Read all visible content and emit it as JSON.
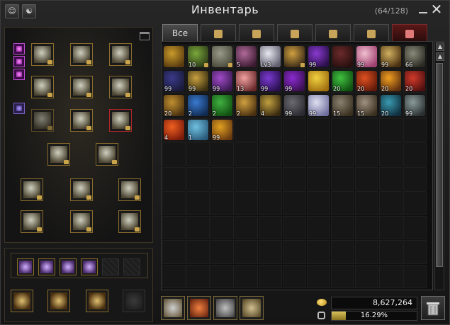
{
  "window": {
    "title": "Инвентарь",
    "slots_used": "(64/128)"
  },
  "tabs": [
    {
      "label": "Все",
      "icon": null,
      "active": true
    },
    {
      "icon": "helmet-icon"
    },
    {
      "icon": "potion-icon"
    },
    {
      "icon": "hammer-icon"
    },
    {
      "icon": "chest-icon"
    },
    {
      "icon": "scroll-icon"
    },
    {
      "icon": "gem-icon",
      "red": true
    }
  ],
  "grid": {
    "columns": 11,
    "rows": 10,
    "items": [
      {
        "c": "#c89a2a",
        "c2": "#5a3b10",
        "qty": ""
      },
      {
        "c": "#7aa83a",
        "c2": "#2c3a18",
        "qty": "10",
        "lock": true
      },
      {
        "c": "#9a9a8a",
        "c2": "#4a4a3a",
        "qty": "",
        "lock": true
      },
      {
        "c": "#b06a9a",
        "c2": "#3a1a30",
        "qty": "5"
      },
      {
        "c": "#e8e8f0",
        "c2": "#606070",
        "qty": "Lv3"
      },
      {
        "c": "#d0a040",
        "c2": "#3a2a18",
        "qty": "",
        "lock": true
      },
      {
        "c": "#8a3ad0",
        "c2": "#2a0f4a",
        "qty": "99"
      },
      {
        "c": "#6a2a2a",
        "c2": "#2a0f0f",
        "qty": ""
      },
      {
        "c": "#f0c0d0",
        "c2": "#a04070",
        "qty": "99"
      },
      {
        "c": "#d0b060",
        "c2": "#4a3010",
        "qty": "99"
      },
      {
        "c": "#8a8a7a",
        "c2": "#2a2a22",
        "qty": "66"
      },
      {
        "c": "#3a3a8a",
        "c2": "#1a1a3a",
        "qty": "99"
      },
      {
        "c": "#c8a040",
        "c2": "#3a3010",
        "qty": "99"
      },
      {
        "c": "#a04ac8",
        "c2": "#3a1a50",
        "qty": "99"
      },
      {
        "c": "#f0a0a0",
        "c2": "#6a2a2a",
        "qty": "13"
      },
      {
        "c": "#7a3ad0",
        "c2": "#2a1050",
        "qty": "99"
      },
      {
        "c": "#8a2ad0",
        "c2": "#3a1050",
        "qty": "99"
      },
      {
        "c": "#f0d040",
        "c2": "#a07010",
        "qty": ""
      },
      {
        "c": "#40c040",
        "c2": "#105010",
        "qty": "20"
      },
      {
        "c": "#e05020",
        "c2": "#601a0a",
        "qty": "20"
      },
      {
        "c": "#f0a020",
        "c2": "#603010",
        "qty": "20"
      },
      {
        "c": "#d03a2a",
        "c2": "#501010",
        "qty": "20"
      },
      {
        "c": "#c09030",
        "c2": "#4a3010",
        "qty": "20"
      },
      {
        "c": "#3a7ad0",
        "c2": "#102a50",
        "qty": "2"
      },
      {
        "c": "#40b040",
        "c2": "#105010",
        "qty": "2"
      },
      {
        "c": "#d0a040",
        "c2": "#4a3010",
        "qty": "2"
      },
      {
        "c": "#c0a040",
        "c2": "#3a2a10",
        "qty": "4"
      },
      {
        "c": "#6a6a70",
        "c2": "#2a2a30",
        "qty": "99"
      },
      {
        "c": "#e0e0f0",
        "c2": "#7070a0",
        "qty": "99"
      },
      {
        "c": "#8a8070",
        "c2": "#3a3020",
        "qty": "15"
      },
      {
        "c": "#a09080",
        "c2": "#3a3020",
        "qty": "15"
      },
      {
        "c": "#3a9ab0",
        "c2": "#103040",
        "qty": "20"
      },
      {
        "c": "#8a9a9a",
        "c2": "#2a3030",
        "qty": "99"
      },
      {
        "c": "#f06020",
        "c2": "#7a1a0a",
        "qty": "4"
      },
      {
        "c": "#70c0e0",
        "c2": "#2a5a7a",
        "qty": "1"
      },
      {
        "c": "#e0a020",
        "c2": "#6a3a10",
        "qty": "99"
      }
    ]
  },
  "currency": {
    "gold": "8,627,264"
  },
  "weight": {
    "percent_label": "16.29%",
    "fraction": 0.1629
  },
  "icons": {
    "header_left_1": "character-icon",
    "header_left_2": "search-person-icon",
    "close": "close-icon",
    "minimize": "minimize-icon",
    "trash": "trash-icon"
  }
}
